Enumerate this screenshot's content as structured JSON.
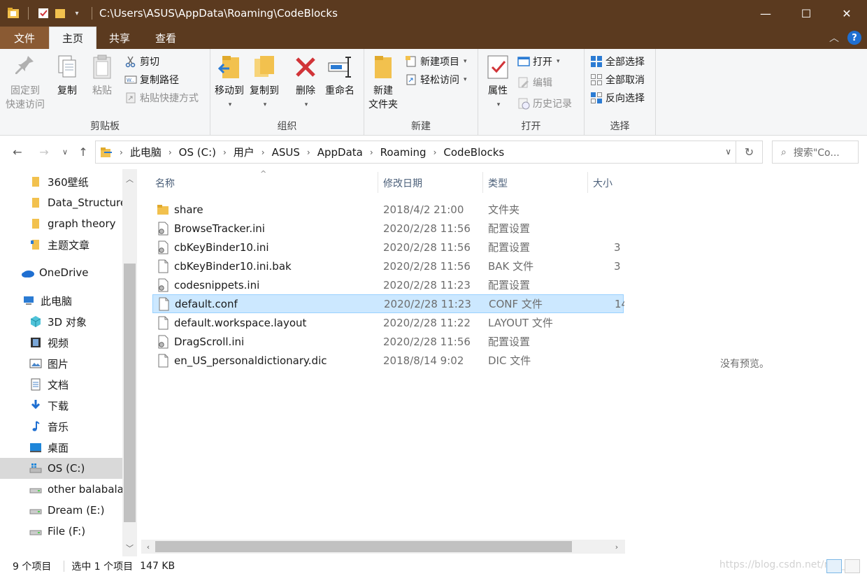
{
  "window": {
    "title": "C:\\Users\\ASUS\\AppData\\Roaming\\CodeBlocks",
    "minimize": "—",
    "maximize": "☐",
    "close": "✕"
  },
  "ribbon_tabs": {
    "file": "文件",
    "home": "主页",
    "share": "共享",
    "view": "查看"
  },
  "ribbon": {
    "clipboard": {
      "label": "剪贴板",
      "pin_line1": "固定到",
      "pin_line2": "快速访问",
      "copy": "复制",
      "paste": "粘贴",
      "cut": "剪切",
      "copy_path": "复制路径",
      "paste_shortcut": "粘贴快捷方式"
    },
    "organize": {
      "label": "组织",
      "move_to": "移动到",
      "copy_to": "复制到",
      "delete": "删除",
      "rename": "重命名"
    },
    "new": {
      "label": "新建",
      "new_folder_line1": "新建",
      "new_folder_line2": "文件夹",
      "new_item": "新建项目",
      "easy_access": "轻松访问"
    },
    "open": {
      "label": "打开",
      "properties": "属性",
      "open": "打开",
      "edit": "编辑",
      "history": "历史记录"
    },
    "select": {
      "label": "选择",
      "select_all": "全部选择",
      "select_none": "全部取消",
      "invert": "反向选择"
    }
  },
  "address": {
    "crumbs": [
      "此电脑",
      "OS (C:)",
      "用户",
      "ASUS",
      "AppData",
      "Roaming",
      "CodeBlocks"
    ],
    "search_placeholder": "搜索\"Co..."
  },
  "nav_pane": {
    "items": [
      {
        "label": "360壁纸",
        "icon": "folder-icon"
      },
      {
        "label": "Data_Structure",
        "icon": "folder-icon"
      },
      {
        "label": "graph theory",
        "icon": "folder-icon"
      },
      {
        "label": "主题文章",
        "icon": "folder-icon"
      },
      {
        "label": "OneDrive",
        "icon": "onedrive-icon"
      },
      {
        "label": "此电脑",
        "icon": "computer-icon"
      },
      {
        "label": "3D 对象",
        "icon": "cube-icon"
      },
      {
        "label": "视频",
        "icon": "video-icon"
      },
      {
        "label": "图片",
        "icon": "pictures-icon"
      },
      {
        "label": "文档",
        "icon": "documents-icon"
      },
      {
        "label": "下载",
        "icon": "download-icon"
      },
      {
        "label": "音乐",
        "icon": "music-icon"
      },
      {
        "label": "桌面",
        "icon": "desktop-icon"
      },
      {
        "label": "OS (C:)",
        "icon": "drive-c-icon"
      },
      {
        "label": "other balabala",
        "icon": "drive-icon"
      },
      {
        "label": "Dream (E:)",
        "icon": "drive-icon"
      },
      {
        "label": "File (F:)",
        "icon": "drive-icon"
      }
    ]
  },
  "columns": {
    "name": "名称",
    "date": "修改日期",
    "type": "类型",
    "size": "大小"
  },
  "files": [
    {
      "name": "share",
      "date": "2018/4/2 21:00",
      "type": "文件夹",
      "size": "",
      "icon": "folder-icon"
    },
    {
      "name": "BrowseTracker.ini",
      "date": "2020/2/28 11:56",
      "type": "配置设置",
      "size": "",
      "icon": "settings-file-icon"
    },
    {
      "name": "cbKeyBinder10.ini",
      "date": "2020/2/28 11:56",
      "type": "配置设置",
      "size": "3",
      "icon": "settings-file-icon"
    },
    {
      "name": "cbKeyBinder10.ini.bak",
      "date": "2020/2/28 11:56",
      "type": "BAK 文件",
      "size": "3",
      "icon": "file-icon"
    },
    {
      "name": "codesnippets.ini",
      "date": "2020/2/28 11:23",
      "type": "配置设置",
      "size": "",
      "icon": "settings-file-icon"
    },
    {
      "name": "default.conf",
      "date": "2020/2/28 11:23",
      "type": "CONF 文件",
      "size": "14",
      "icon": "file-icon",
      "selected": true
    },
    {
      "name": "default.workspace.layout",
      "date": "2020/2/28 11:22",
      "type": "LAYOUT 文件",
      "size": "",
      "icon": "file-icon"
    },
    {
      "name": "DragScroll.ini",
      "date": "2020/2/28 11:56",
      "type": "配置设置",
      "size": "",
      "icon": "settings-file-icon"
    },
    {
      "name": "en_US_personaldictionary.dic",
      "date": "2018/8/14 9:02",
      "type": "DIC 文件",
      "size": "",
      "icon": "file-icon"
    }
  ],
  "preview": {
    "message": "没有预览。"
  },
  "status": {
    "count": "9 个项目",
    "selected": "选中 1 个项目",
    "size": "147 KB",
    "watermark": "https://blog.csdn.net/m0_37"
  },
  "colors": {
    "titlebar": "#5b3a1f",
    "file_tab": "#8a5a33",
    "selection": "#cce8ff",
    "accent_blue": "#1f6fd1"
  }
}
